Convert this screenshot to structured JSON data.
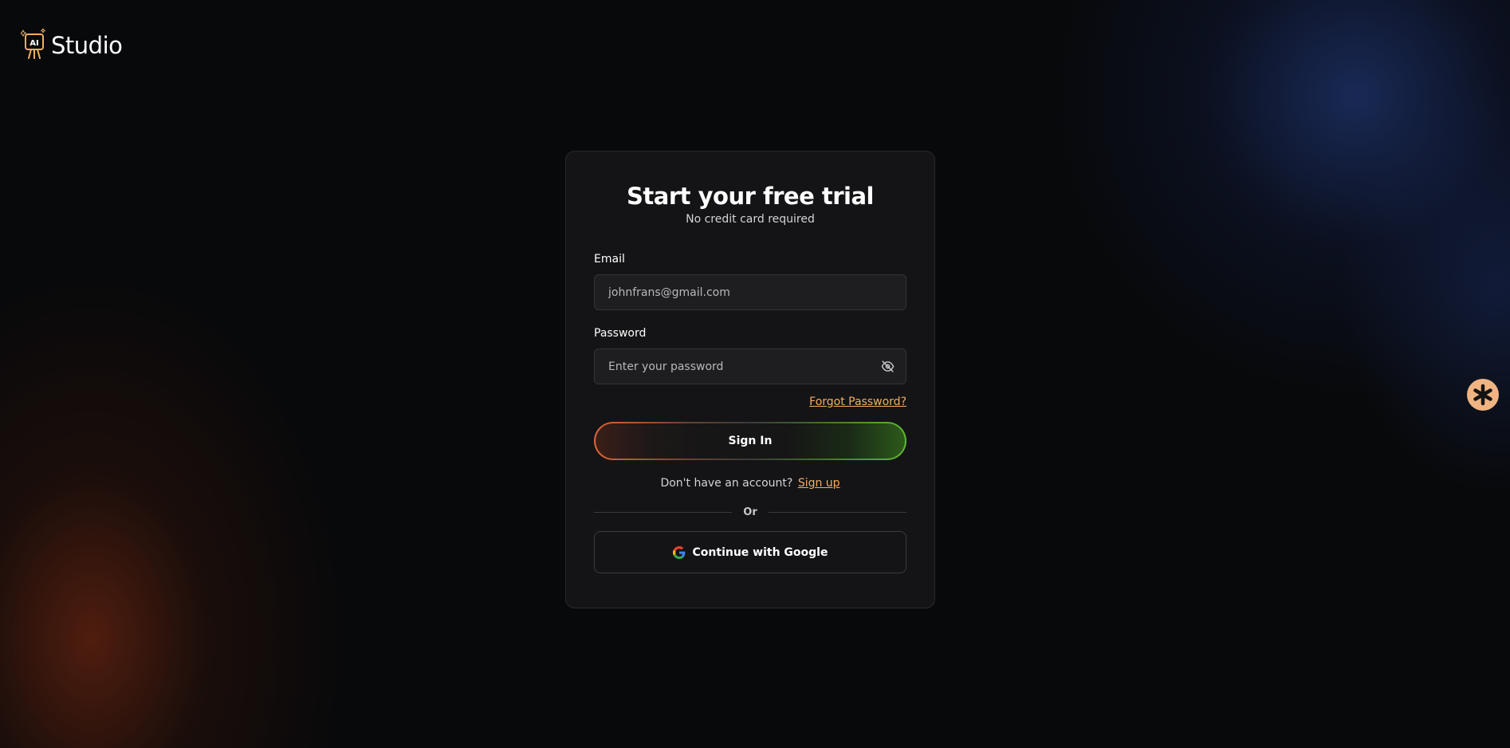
{
  "brand": {
    "name": "Studio",
    "logo_icon": "ai-robot-sparkle-icon",
    "logo_text": "AI",
    "accent_color": "#f2ae62"
  },
  "signin_card": {
    "title": "Start your free trial",
    "subtitle": "No credit card required",
    "email": {
      "label": "Email",
      "value": "",
      "placeholder": "johnfrans@gmail.com"
    },
    "password": {
      "label": "Password",
      "value": "",
      "placeholder": "Enter your password",
      "toggle_icon": "eye-off-icon"
    },
    "forgot_password": "Forgot Password?",
    "signin_button": "Sign In",
    "signup_prompt": "Don't have an account?",
    "signup_link": "Sign up",
    "divider_text": "Or",
    "google_button": "Continue with Google",
    "google_icon": "google-g-icon"
  },
  "help_widget": {
    "icon": "asterisk-icon",
    "color": "#f0b482"
  }
}
